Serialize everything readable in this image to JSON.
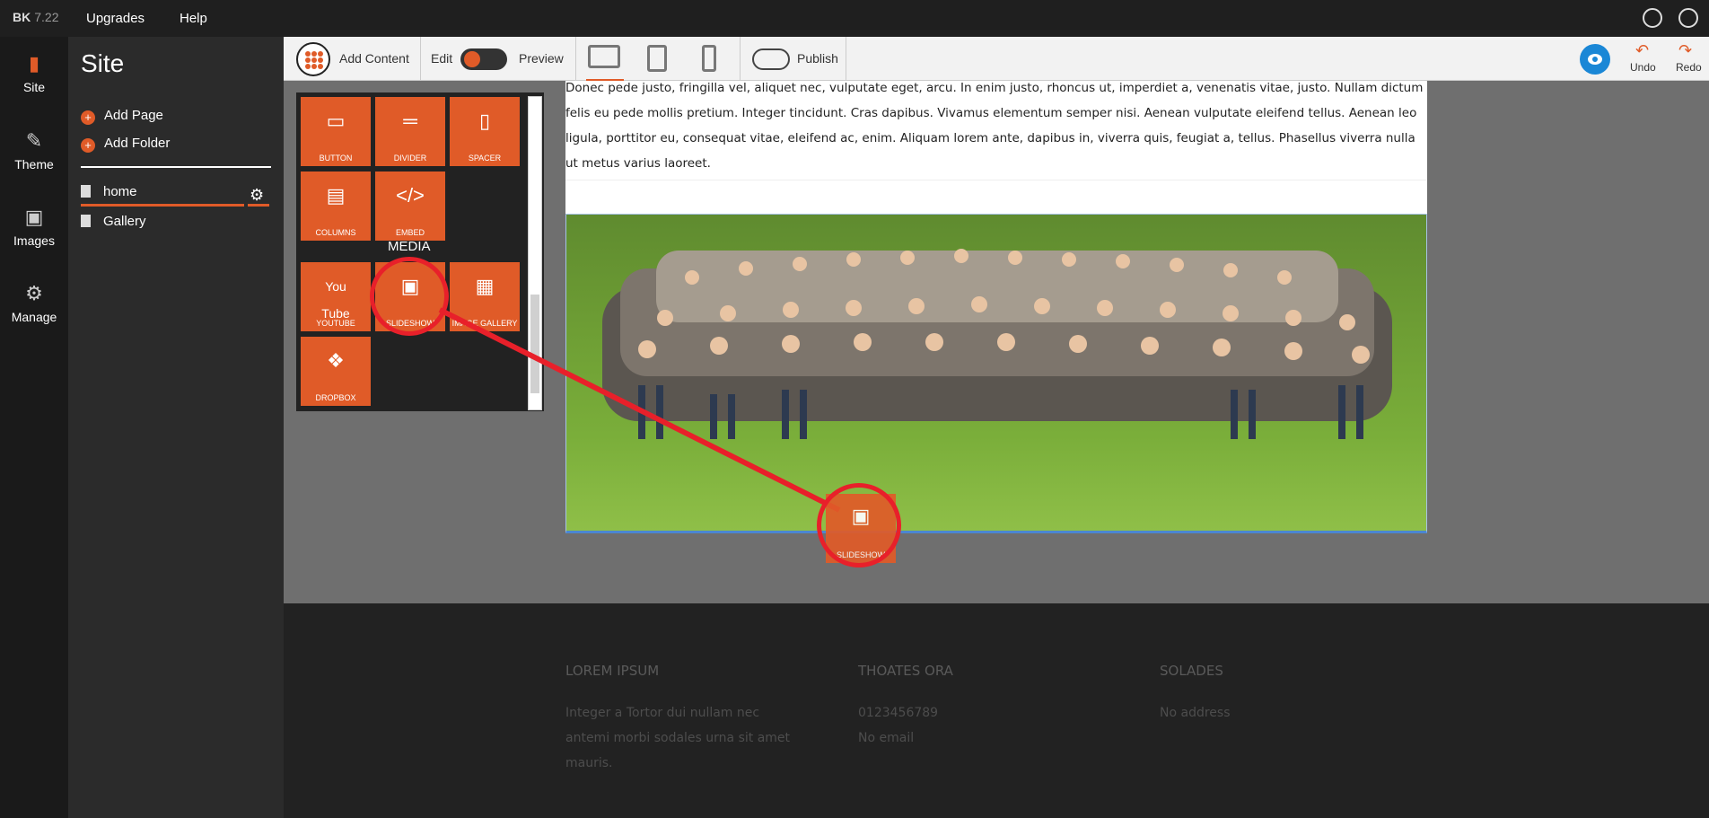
{
  "topbar": {
    "logo": "BK",
    "version": "7.22",
    "menu": [
      "Upgrades",
      "Help"
    ]
  },
  "leftnav": [
    {
      "label": "Site",
      "icon": "document-icon"
    },
    {
      "label": "Theme",
      "icon": "brush-icon"
    },
    {
      "label": "Images",
      "icon": "image-icon"
    },
    {
      "label": "Manage",
      "icon": "gear-icon"
    }
  ],
  "sidepanel": {
    "title": "Site",
    "add_page": "Add Page",
    "add_folder": "Add Folder",
    "pages": [
      "home",
      "Gallery"
    ]
  },
  "toolbar": {
    "add_content": "Add Content",
    "edit": "Edit",
    "preview": "Preview",
    "publish": "Publish",
    "undo": "Undo",
    "redo": "Redo"
  },
  "content_panel": {
    "tiles_top": [
      "BUTTON",
      "DIVIDER",
      "SPACER",
      "COLUMNS",
      "EMBED"
    ],
    "media_heading": "MEDIA",
    "media_tiles": [
      "YOUTUBE",
      "SLIDESHOW",
      "IMAGE GALLERY",
      "DROPBOX"
    ]
  },
  "drag_tile": "SLIDESHOW",
  "page": {
    "body_text": "Donec pede justo, fringilla vel, aliquet nec, vulputate eget, arcu. In enim justo, rhoncus ut, imperdiet a, venenatis vitae, justo. Nullam dictum felis eu pede mollis pretium. Integer tincidunt. Cras dapibus. Vivamus elementum semper nisi. Aenean vulputate eleifend tellus. Aenean leo ligula, porttitor eu, consequat vitae, eleifend ac, enim. Aliquam lorem ante, dapibus in, viverra quis, feugiat a, tellus. Phasellus viverra nulla ut metus varius laoreet."
  },
  "footer": {
    "col1_head": "LOREM IPSUM",
    "col1_text": "Integer a Tortor dui nullam nec antemi morbi sodales urna sit amet mauris.",
    "col2_head": "THOATES ORA",
    "col2_phone": "0123456789",
    "col2_email": "No email",
    "col3_head": "SOLADES",
    "col3_address": "No address"
  },
  "colors": {
    "accent": "#e05b28",
    "highlight": "#e8202a",
    "preview_blue": "#1a87d6"
  }
}
